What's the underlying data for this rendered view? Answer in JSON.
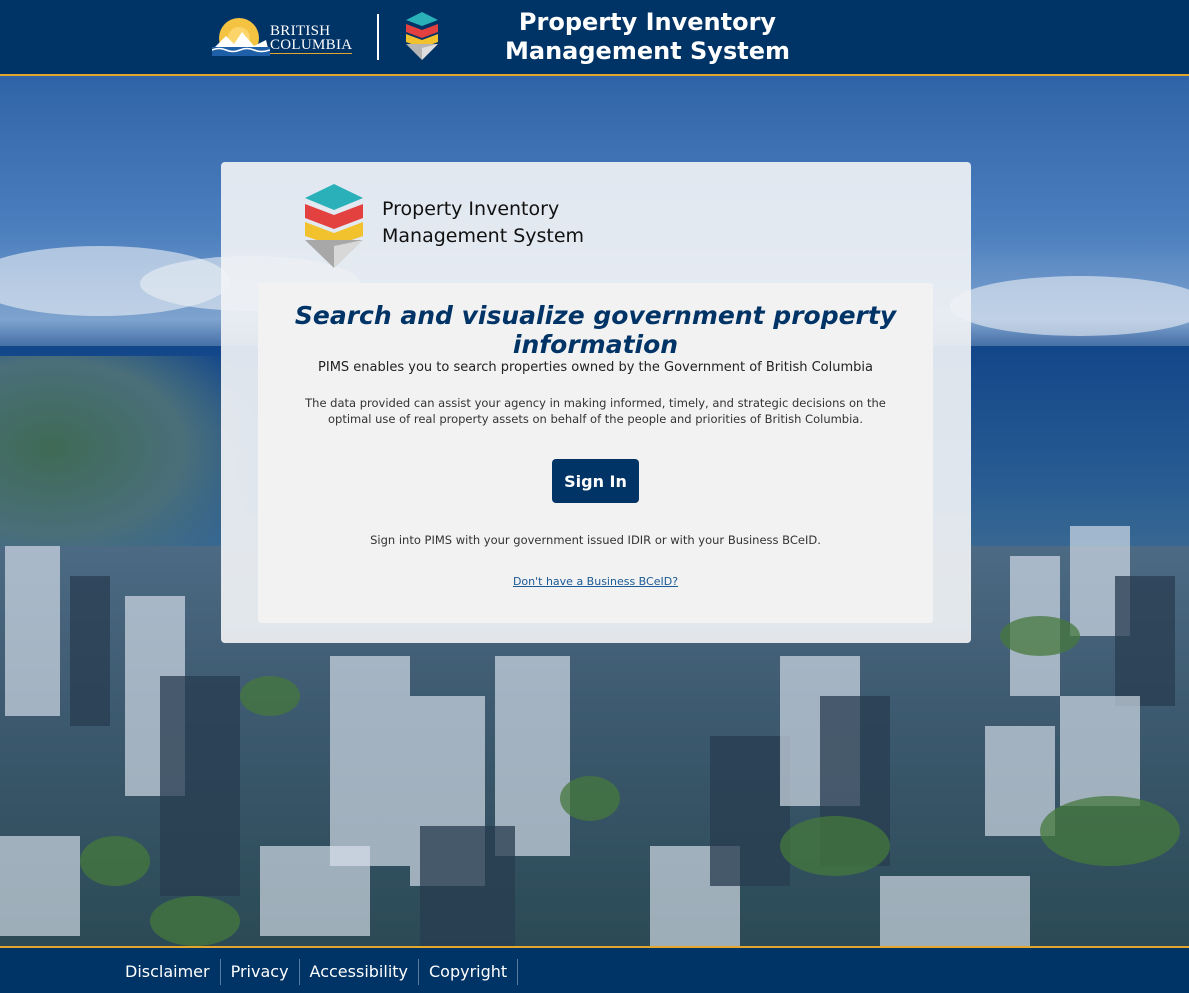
{
  "header": {
    "bc_logo_line1": "BRITISH",
    "bc_logo_line2": "COLUMBIA",
    "title_line1": "Property Inventory",
    "title_line2": "Management System"
  },
  "card": {
    "logo_title_line1": "Property Inventory",
    "logo_title_line2": "Management System",
    "headline": "Search and visualize government property information",
    "intro": "PIMS enables you to search properties owned by the Government of British Columbia",
    "description": "The data provided can assist your agency in making informed, timely, and strategic decisions on the optimal use of real property assets on behalf of the people and priorities of British Columbia.",
    "sign_in_label": "Sign In",
    "sign_in_note": "Sign into PIMS with your government issued IDIR or with your Business BCeID.",
    "bceid_link": "Don't have a Business BCeID?"
  },
  "footer": {
    "links": [
      "Disclaimer",
      "Privacy",
      "Accessibility",
      "Copyright"
    ]
  },
  "colors": {
    "primary": "#003366",
    "accent_gold": "#e3a82b",
    "link": "#1a5a96"
  },
  "icons": {
    "bc_logo": "bc-sun-mountain-logo",
    "pims_logo": "pims-layered-diamond-logo"
  }
}
